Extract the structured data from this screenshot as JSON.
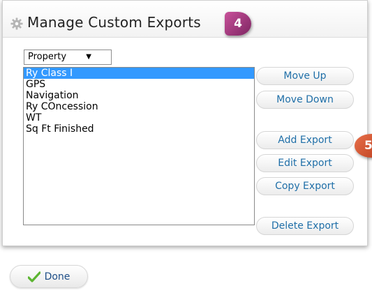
{
  "dialog": {
    "title": "Manage Custom Exports",
    "title_icon": "gear-icon",
    "callout_badge_1": "4",
    "callout_badge_2": "5"
  },
  "property_select": {
    "selected": "Property"
  },
  "export_list": {
    "items": [
      {
        "label": "Ry Class I",
        "selected": true
      },
      {
        "label": "GPS",
        "selected": false
      },
      {
        "label": "Navigation",
        "selected": false
      },
      {
        "label": "Ry COncession",
        "selected": false
      },
      {
        "label": "WT",
        "selected": false
      },
      {
        "label": "Sq Ft Finished",
        "selected": false
      }
    ]
  },
  "buttons": {
    "move_up": "Move Up",
    "move_down": "Move Down",
    "add_export": "Add Export",
    "edit_export": "Edit Export",
    "copy_export": "Copy Export",
    "delete_export": "Delete Export",
    "done": "Done"
  },
  "colors": {
    "selection": "#3399ff",
    "button_text": "#1f6fa8",
    "badge_4": "#a93a7f",
    "badge_5": "#d45530",
    "check_icon": "#5cb531"
  }
}
